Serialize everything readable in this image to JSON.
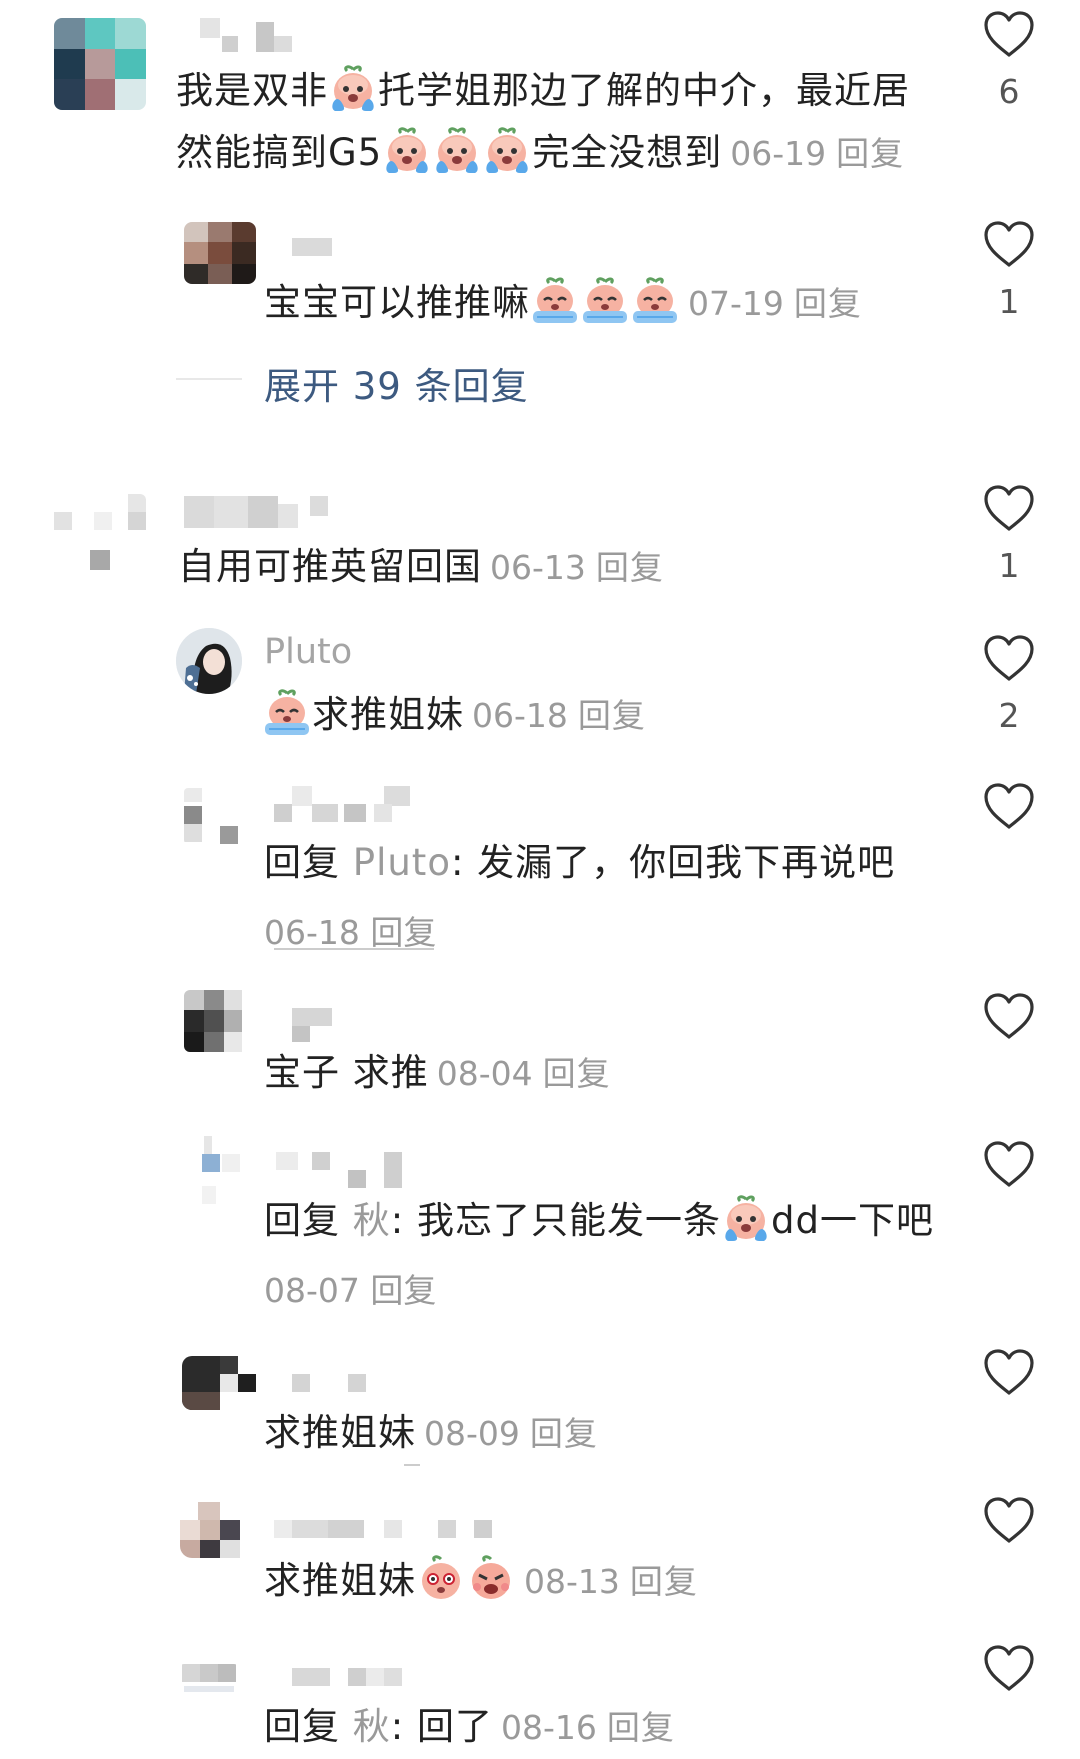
{
  "heart_icon": "heart-outline-icon",
  "emoji_icon": "crying-peach-emoji",
  "comments": [
    {
      "text_before": "我是双非",
      "text_middle": "托学姐那边了解的中介，最近居",
      "line2_text": "然能搞到G5",
      "line2_after": "完全没想到",
      "date": "06-19",
      "reply_label": "回复",
      "likes": "6"
    },
    {
      "text": "宝宝可以推推嘛",
      "date": "07-19",
      "reply_label": "回复",
      "likes": "1"
    },
    {
      "text": "自用可推英留回国",
      "date": "06-13",
      "reply_label": "回复",
      "likes": "1"
    },
    {
      "username": "Pluto",
      "text": "求推姐妹",
      "date": "06-18",
      "reply_label": "回复",
      "likes": "2"
    },
    {
      "prefix": "回复",
      "reply_to": "Pluto",
      "text": ": 发漏了，你回我下再说吧",
      "date": "06-18",
      "reply_label": "回复"
    },
    {
      "text": "宝子 求推",
      "date": "08-04",
      "reply_label": "回复"
    },
    {
      "prefix": "回复",
      "reply_to": "秋",
      "text_before": ": 我忘了只能发一条",
      "text_after": "dd一下吧",
      "date": "08-07",
      "reply_label": "回复"
    },
    {
      "text": "求推姐妹",
      "date": "08-09",
      "reply_label": "回复"
    },
    {
      "text": "求推姐妹",
      "date": "08-13",
      "reply_label": "回复"
    },
    {
      "prefix": "回复",
      "reply_to": "秋",
      "text": ": 回了",
      "date": "08-16",
      "reply_label": "回复"
    }
  ],
  "expand": {
    "label": "展开 39 条回复"
  }
}
